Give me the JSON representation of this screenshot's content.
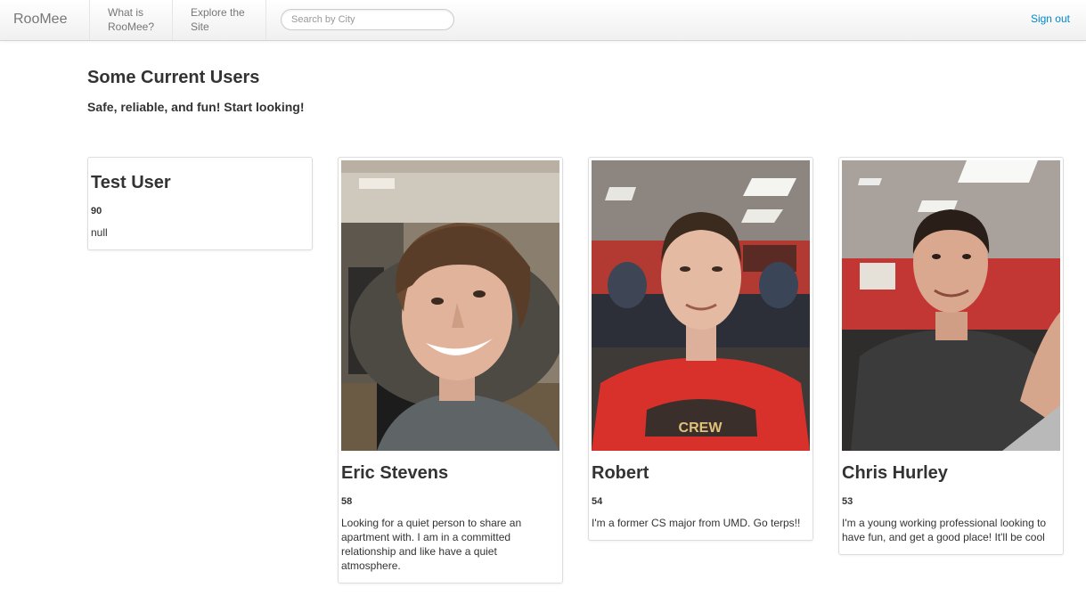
{
  "navbar": {
    "brand": "RooMee",
    "what_is": "What is RooMee?",
    "explore": "Explore the Site",
    "search_placeholder": "Search by City",
    "sign_out": "Sign out"
  },
  "page": {
    "title": "Some Current Users",
    "subtitle": "Safe, reliable, and fun! Start looking!"
  },
  "users": [
    {
      "name": "Test User",
      "age": "90",
      "bio": "null"
    },
    {
      "name": "Eric Stevens",
      "age": "58",
      "bio": "Looking for a quiet person to share an apartment with. I am in a committed relationship and like have a quiet atmosphere."
    },
    {
      "name": "Robert",
      "age": "54",
      "bio": "I'm a former CS major from UMD. Go terps!!"
    },
    {
      "name": "Chris Hurley",
      "age": "53",
      "bio": "I'm a young working professional looking to have fun, and get a good place! It'll be cool"
    }
  ],
  "colors": {
    "link": "#0088cc",
    "nav_text": "#777777",
    "heading": "#333333",
    "card_border": "#dddddd"
  }
}
